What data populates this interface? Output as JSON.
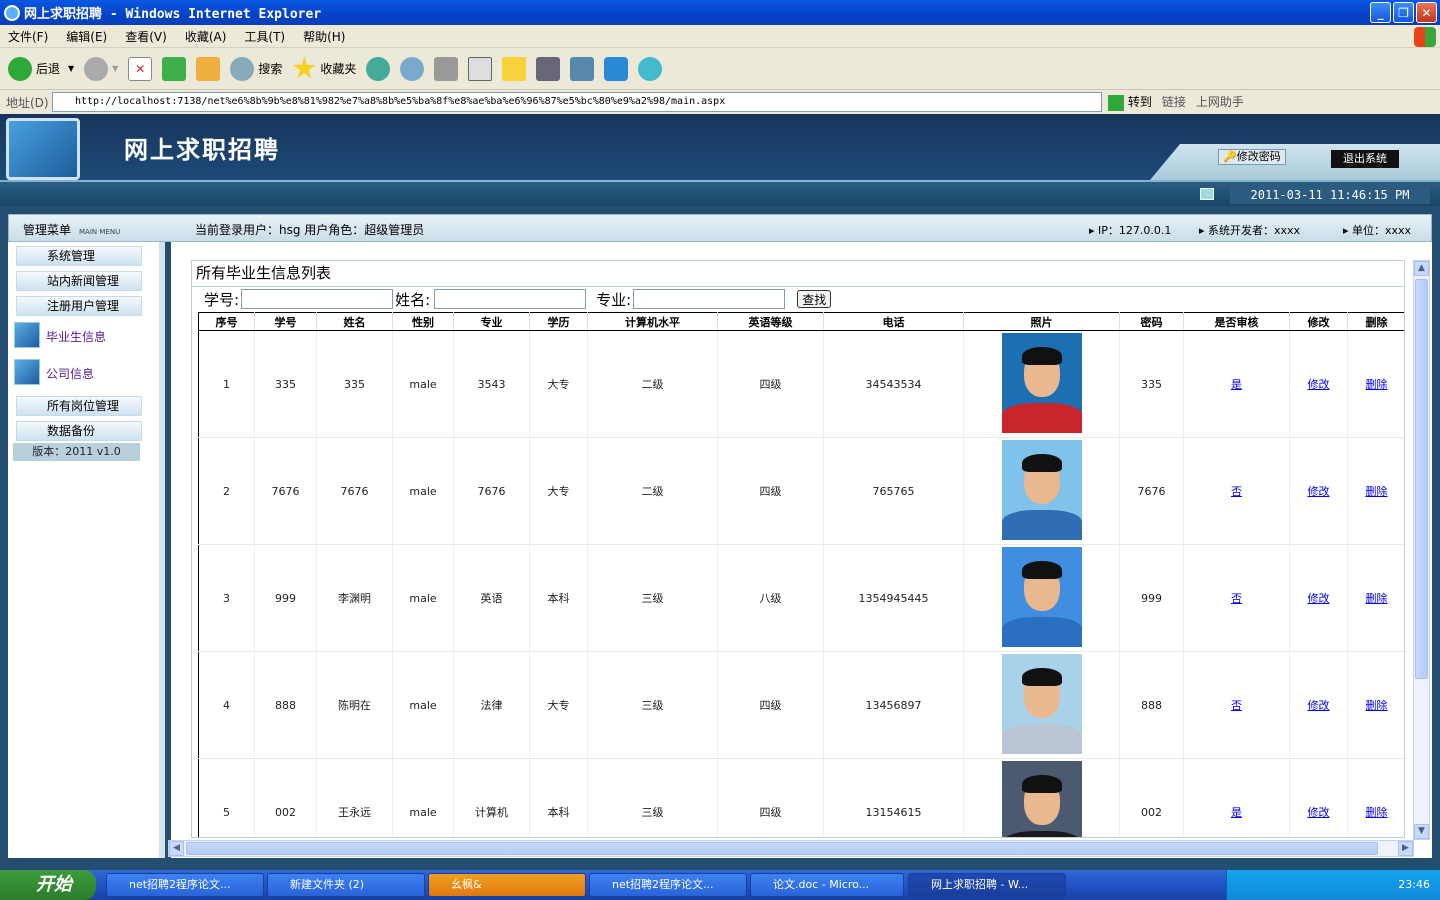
{
  "window": {
    "title": "网上求职招聘 - Windows Internet Explorer"
  },
  "menu": [
    "文件(F)",
    "编辑(E)",
    "查看(V)",
    "收藏(A)",
    "工具(T)",
    "帮助(H)"
  ],
  "toolbar": {
    "back": "后退",
    "search": "搜索",
    "favorites": "收藏夹"
  },
  "address": {
    "label": "地址(D)",
    "url": "http://localhost:7138/net%e6%8b%9b%e8%81%982%e7%a8%8b%e5%ba%8f%e8%ae%ba%e6%96%87%e5%bc%80%e9%a2%98/main.aspx",
    "go": "转到",
    "links": "链接",
    "helper": "上网助手"
  },
  "site": {
    "title": "网上求职招聘",
    "change_pwd": "修改密码",
    "logout": "退出系统",
    "datetime": "2011-03-11 11:46:15 PM"
  },
  "infobar": {
    "menu_title": "管理菜单",
    "menu_sub": "MAIN MENU",
    "user": "当前登录用户：hsg  用户角色：超级管理员",
    "ip": "IP：127.0.0.1",
    "developer": "系统开发者：xxxx",
    "unit": "单位：xxxx"
  },
  "sidebar": {
    "items": [
      "系统管理",
      "站内新闻管理",
      "注册用户管理",
      "毕业生信息",
      "公司信息",
      "所有岗位管理",
      "数据备份"
    ],
    "version": "版本：2011  v1.0"
  },
  "main": {
    "panel_title": "所有毕业生信息列表",
    "search": {
      "no_label": "学号:",
      "name_label": "姓名:",
      "major_label": "专业:",
      "button": "查找"
    },
    "columns": [
      "序号",
      "学号",
      "姓名",
      "性别",
      "专业",
      "学历",
      "计算机水平",
      "英语等级",
      "电话",
      "照片",
      "密码",
      "是否审核",
      "修改",
      "删除"
    ],
    "rows": [
      {
        "no": "1",
        "sid": "335",
        "name": "335",
        "sex": "male",
        "major": "3543",
        "edu": "大专",
        "comp": "二级",
        "eng": "四级",
        "phone": "34543534",
        "pwd": "335",
        "audit": "是",
        "edit": "修改",
        "del": "删除"
      },
      {
        "no": "2",
        "sid": "7676",
        "name": "7676",
        "sex": "male",
        "major": "7676",
        "edu": "大专",
        "comp": "二级",
        "eng": "四级",
        "phone": "765765",
        "pwd": "7676",
        "audit": "否",
        "edit": "修改",
        "del": "删除"
      },
      {
        "no": "3",
        "sid": "999",
        "name": "李渊明",
        "sex": "male",
        "major": "英语",
        "edu": "本科",
        "comp": "三级",
        "eng": "八级",
        "phone": "1354945445",
        "pwd": "999",
        "audit": "否",
        "edit": "修改",
        "del": "删除"
      },
      {
        "no": "4",
        "sid": "888",
        "name": "陈明在",
        "sex": "male",
        "major": "法律",
        "edu": "大专",
        "comp": "三级",
        "eng": "四级",
        "phone": "13456897",
        "pwd": "888",
        "audit": "否",
        "edit": "修改",
        "del": "删除"
      },
      {
        "no": "5",
        "sid": "002",
        "name": "王永远",
        "sex": "male",
        "major": "计算机",
        "edu": "本科",
        "comp": "三级",
        "eng": "四级",
        "phone": "13154615",
        "pwd": "002",
        "audit": "是",
        "edit": "修改",
        "del": "删除"
      }
    ],
    "photo_colors": [
      {
        "bg": "#1c6fb2",
        "shirt": "#c8252c"
      },
      {
        "bg": "#7fc2ea",
        "shirt": "#2f6db5"
      },
      {
        "bg": "#3f8ee0",
        "shirt": "#2a6fc0"
      },
      {
        "bg": "#a9d2ea",
        "shirt": "#b9c5d4"
      },
      {
        "bg": "#4c5a70",
        "shirt": "#1a1a1a"
      }
    ]
  },
  "taskbar": {
    "start": "开始",
    "tasks": [
      "net招聘2程序论文...",
      "新建文件夹 (2)",
      "幺枫&",
      "net招聘2程序论文...",
      "论文.doc - Micro...",
      "网上求职招聘 - W..."
    ],
    "time": "23:46"
  }
}
